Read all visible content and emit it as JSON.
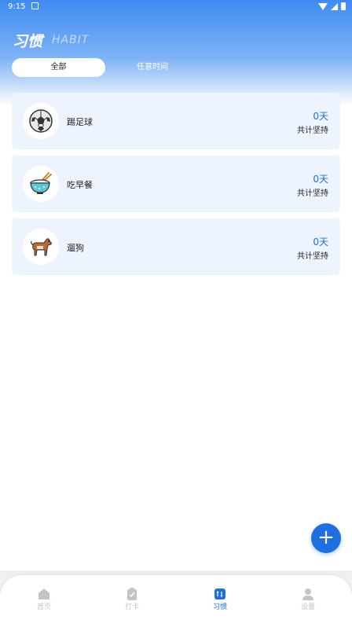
{
  "status": {
    "time": "9:15"
  },
  "header": {
    "title": "习惯",
    "subtitle": "HABIT"
  },
  "tabs": [
    {
      "label": "全部",
      "active": true
    },
    {
      "label": "任意时间",
      "active": false
    }
  ],
  "habits": [
    {
      "name": "踢足球",
      "days": "0天",
      "caption": "共计坚持",
      "icon": "soccer-ball-icon"
    },
    {
      "name": "吃早餐",
      "days": "0天",
      "caption": "共计坚持",
      "icon": "rice-bowl-icon"
    },
    {
      "name": "遛狗",
      "days": "0天",
      "caption": "共计坚持",
      "icon": "dog-icon"
    }
  ],
  "fab": {
    "label": "+"
  },
  "nav": [
    {
      "label": "首页",
      "icon": "home-icon",
      "active": false
    },
    {
      "label": "打卡",
      "icon": "clipboard-check-icon",
      "active": false
    },
    {
      "label": "习惯",
      "icon": "habit-icon",
      "active": true
    },
    {
      "label": "设置",
      "icon": "user-settings-icon",
      "active": false
    }
  ],
  "colors": {
    "accent": "#1f6fe0",
    "card_bg": "#eef4fd",
    "inactive": "#c4c4c4"
  }
}
